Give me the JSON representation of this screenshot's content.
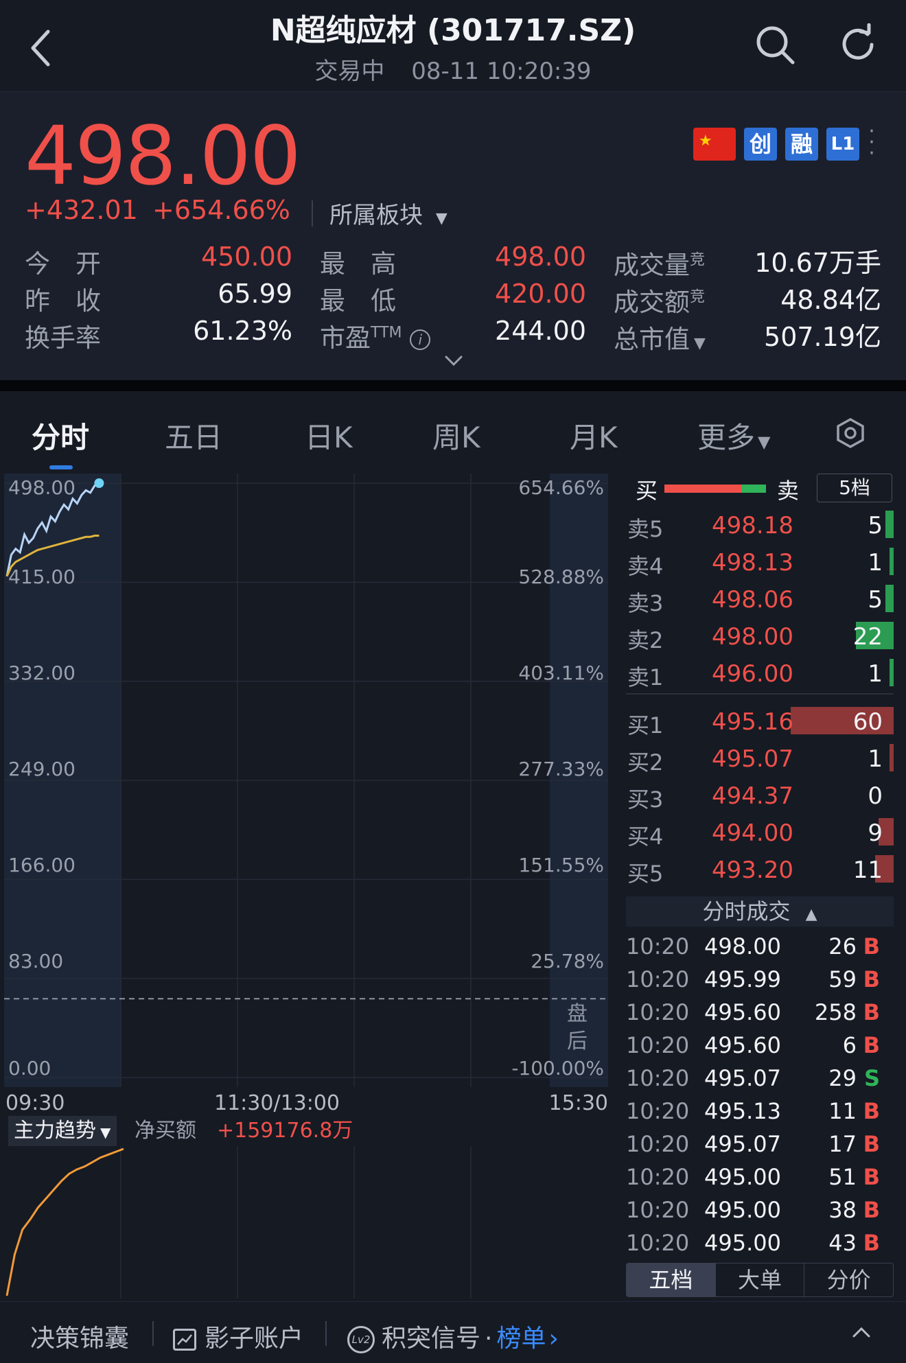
{
  "header": {
    "title": "N超纯应材 (301717.SZ)",
    "status": "交易中",
    "datetime": "08-11 10:20:39"
  },
  "quote": {
    "price": "498.00",
    "change": "+432.01",
    "change_pct": "+654.66%",
    "sector_label": "所属板块",
    "badges": [
      "创",
      "融",
      "L1"
    ],
    "stats": [
      {
        "label": "今　开",
        "value": "450.00",
        "color": "#f0504a"
      },
      {
        "label": "昨　收",
        "value": "65.99",
        "color": "#f2f3f6"
      },
      {
        "label": "换手率",
        "value": "61.23%",
        "color": "#f2f3f6"
      },
      {
        "label": "最　高",
        "value": "498.00",
        "color": "#f0504a"
      },
      {
        "label": "最　低",
        "value": "420.00",
        "color": "#f0504a"
      },
      {
        "label": "市盈",
        "sup": "TTM",
        "value": "244.00",
        "color": "#f2f3f6"
      },
      {
        "label": "成交量",
        "sup": "竞",
        "value": "10.67万手",
        "color": "#f2f3f6"
      },
      {
        "label": "成交额",
        "sup": "竞",
        "value": "48.84亿",
        "color": "#f2f3f6"
      },
      {
        "label": "总市值",
        "value": "507.19亿",
        "color": "#f2f3f6"
      }
    ]
  },
  "tabs": [
    {
      "label": "分时",
      "active": true
    },
    {
      "label": "五日"
    },
    {
      "label": "日K"
    },
    {
      "label": "周K"
    },
    {
      "label": "月K"
    },
    {
      "label": "更多"
    }
  ],
  "chart_data": {
    "type": "line",
    "y_left_ticks": [
      "498.00",
      "415.00",
      "332.00",
      "249.00",
      "166.00",
      "83.00",
      "0.00"
    ],
    "y_right_ticks": [
      "654.66%",
      "528.88%",
      "403.11%",
      "277.33%",
      "151.55%",
      "25.78%",
      "-100.00%"
    ],
    "x_ticks": [
      "09:30",
      "11:30/13:00",
      "15:30"
    ],
    "ylim": [
      0,
      498
    ],
    "prev_close": 65.99,
    "after_hours_label": "盘后",
    "series": [
      {
        "values": [
          420,
          438,
          443,
          440,
          455,
          448,
          452,
          460,
          465,
          458,
          470,
          466,
          474,
          480,
          476,
          485,
          481,
          488,
          492,
          490,
          496,
          498
        ]
      },
      {
        "values": [
          420,
          428,
          432,
          434,
          436,
          438,
          440,
          442,
          443,
          444,
          445,
          446,
          447,
          448,
          449,
          450,
          451,
          452,
          453,
          453,
          454,
          454
        ]
      }
    ],
    "x_count": 241
  },
  "indicator": {
    "selector": "主力趋势",
    "net_label": "净买额",
    "net_value": "+159176.8万",
    "series": [
      0,
      28,
      45,
      52,
      60,
      66,
      72,
      78,
      83,
      86,
      88,
      91,
      94,
      96,
      98,
      100
    ]
  },
  "orderbook": {
    "buy_label": "买",
    "sell_label": "卖",
    "depth_button": "5档",
    "asks": [
      {
        "label": "卖5",
        "price": "498.18",
        "vol": "5",
        "ratio": 0.08
      },
      {
        "label": "卖4",
        "price": "498.13",
        "vol": "1",
        "ratio": 0.02
      },
      {
        "label": "卖3",
        "price": "498.06",
        "vol": "5",
        "ratio": 0.08
      },
      {
        "label": "卖2",
        "price": "498.00",
        "vol": "22",
        "ratio": 0.37
      },
      {
        "label": "卖1",
        "price": "496.00",
        "vol": "1",
        "ratio": 0.02
      }
    ],
    "bids": [
      {
        "label": "买1",
        "price": "495.16",
        "vol": "60",
        "ratio": 1.0
      },
      {
        "label": "买2",
        "price": "495.07",
        "vol": "1",
        "ratio": 0.02
      },
      {
        "label": "买3",
        "price": "494.37",
        "vol": "0",
        "ratio": 0.0
      },
      {
        "label": "买4",
        "price": "494.00",
        "vol": "9",
        "ratio": 0.15
      },
      {
        "label": "买5",
        "price": "493.20",
        "vol": "11",
        "ratio": 0.18
      }
    ],
    "ratio_bar": {
      "buy": 0.76,
      "sell": 0.24
    }
  },
  "trades": {
    "title": "分时成交",
    "rows": [
      {
        "time": "10:20",
        "price": "498.00",
        "vol": "26",
        "side": "B"
      },
      {
        "time": "10:20",
        "price": "495.99",
        "vol": "59",
        "side": "B"
      },
      {
        "time": "10:20",
        "price": "495.60",
        "vol": "258",
        "side": "B"
      },
      {
        "time": "10:20",
        "price": "495.60",
        "vol": "6",
        "side": "B"
      },
      {
        "time": "10:20",
        "price": "495.07",
        "vol": "29",
        "side": "S"
      },
      {
        "time": "10:20",
        "price": "495.13",
        "vol": "11",
        "side": "B"
      },
      {
        "time": "10:20",
        "price": "495.07",
        "vol": "17",
        "side": "B"
      },
      {
        "time": "10:20",
        "price": "495.00",
        "vol": "51",
        "side": "B"
      },
      {
        "time": "10:20",
        "price": "495.00",
        "vol": "38",
        "side": "B"
      },
      {
        "time": "10:20",
        "price": "495.00",
        "vol": "43",
        "side": "B"
      }
    ],
    "segments": [
      "五档",
      "大单",
      "分价"
    ]
  },
  "bottom_bar": {
    "item1": "决策锦囊",
    "item2": "影子账户",
    "item3": "积突信号",
    "item3_sep": "·",
    "item3_link": "榜单",
    "lv2_badge": "Lv2"
  },
  "colors": {
    "up": "#f0504a",
    "down": "#2fb45a",
    "accent": "#2f7de1",
    "price_line": "#b9d4f5",
    "avg_line": "#e0b43c"
  }
}
